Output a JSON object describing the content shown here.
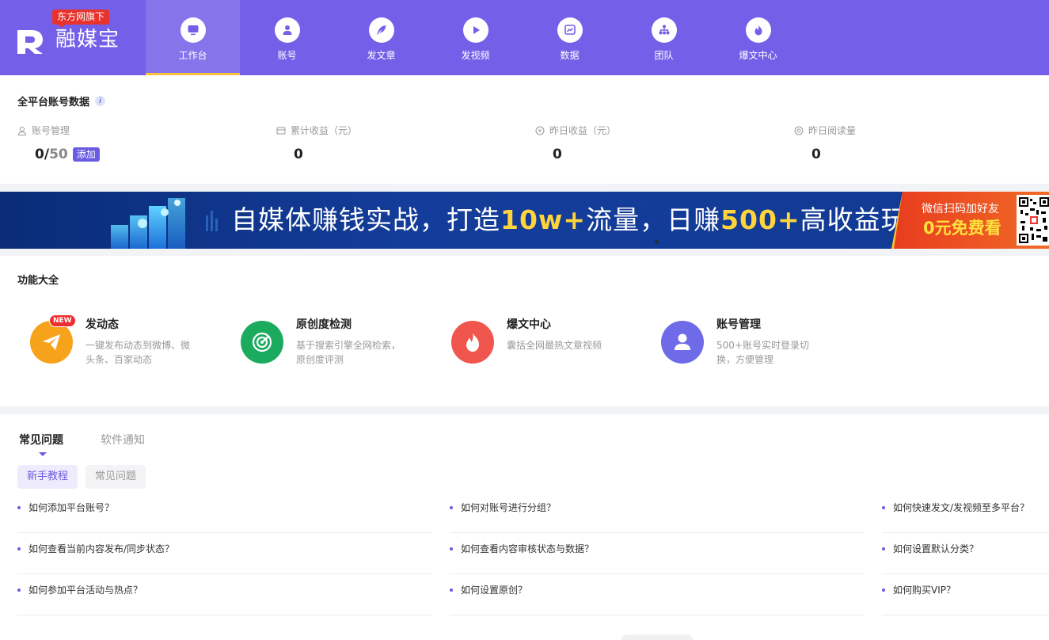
{
  "brand": {
    "tag": "东方网旗下",
    "name": "融媒宝"
  },
  "nav": [
    {
      "label": "工作台",
      "icon": "monitor-icon",
      "active": true
    },
    {
      "label": "账号",
      "icon": "user-icon",
      "active": false
    },
    {
      "label": "发文章",
      "icon": "feather-icon",
      "active": false
    },
    {
      "label": "发视频",
      "icon": "play-icon",
      "active": false
    },
    {
      "label": "数据",
      "icon": "chart-icon",
      "active": false
    },
    {
      "label": "团队",
      "icon": "team-icon",
      "active": false
    },
    {
      "label": "爆文中心",
      "icon": "fire-icon",
      "active": false
    }
  ],
  "stats": {
    "title": "全平台账号数据",
    "info_icon": "i",
    "account": {
      "label": "账号管理",
      "current": "0",
      "sep": "/",
      "max": "50",
      "add": "添加"
    },
    "total_income": {
      "label": "累计收益（元）",
      "value": "0"
    },
    "yesterday_income": {
      "label": "昨日收益（元）",
      "value": "0"
    },
    "yesterday_reads": {
      "label": "昨日阅读量",
      "value": "0"
    }
  },
  "banner": {
    "part1": "自媒体赚钱实战，打造",
    "hl1": "10w+",
    "part2": "流量，日赚",
    "hl2": "500+",
    "part3": "高收益玩法",
    "cta_line1": "微信扫码加好友",
    "cta_line2": "0元免费看"
  },
  "features": {
    "title": "功能大全",
    "items": [
      {
        "name": "发动态",
        "desc": "一键发布动态到微博、微头条、百家动态",
        "badge": "NEW",
        "icon": "paper-plane-icon",
        "color": "#f7a21b"
      },
      {
        "name": "原创度检测",
        "desc": "基于搜索引擎全网检索，原创度评测",
        "badge": "",
        "icon": "radar-icon",
        "color": "#1aab5e"
      },
      {
        "name": "爆文中心",
        "desc": "囊括全网最热文章视频",
        "badge": "",
        "icon": "flame-icon",
        "color": "#f0564d"
      },
      {
        "name": "账号管理",
        "desc": "500+账号实时登录切换，方便管理",
        "badge": "",
        "icon": "person-icon",
        "color": "#6e6ae8"
      }
    ]
  },
  "faq": {
    "tabs": [
      "常见问题",
      "软件通知"
    ],
    "subtabs": [
      "新手教程",
      "常见问题"
    ],
    "questions": [
      [
        "如何添加平台账号？",
        "如何对账号进行分组？",
        "如何快速发文/发视频至多平台？"
      ],
      [
        "如何查看当前内容发布/同步状态？",
        "如何查看内容审核状态与数据？",
        "如何设置默认分类？"
      ],
      [
        "如何参加平台活动与热点？",
        "如何设置原创？",
        "如何购买VIP？"
      ]
    ]
  },
  "colors": {
    "nav_bg": "#7460e8",
    "accent": "#6a5be4",
    "active_underline": "#f5c33b",
    "banner_highlight": "#ffd43b"
  }
}
